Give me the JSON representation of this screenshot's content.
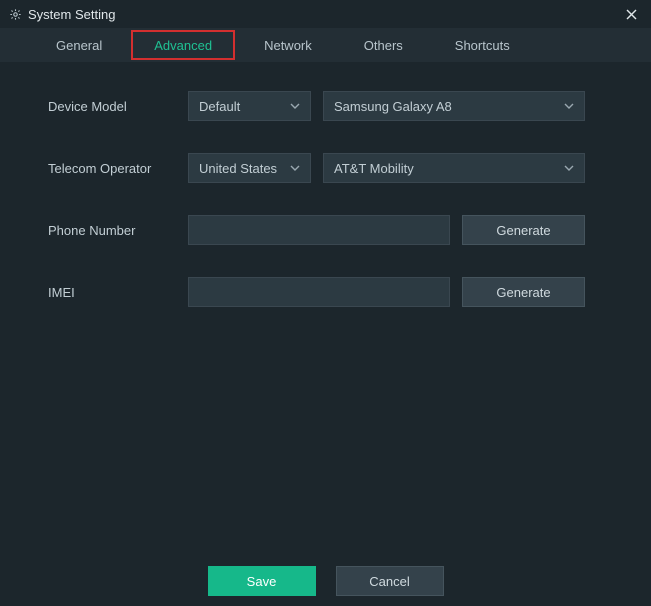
{
  "window": {
    "title": "System Setting"
  },
  "tabs": {
    "general": "General",
    "advanced": "Advanced",
    "network": "Network",
    "others": "Others",
    "shortcuts": "Shortcuts"
  },
  "form": {
    "device_model": {
      "label": "Device Model",
      "brand": "Default",
      "model": "Samsung Galaxy A8"
    },
    "telecom_operator": {
      "label": "Telecom Operator",
      "country": "United States",
      "operator": "AT&T Mobility"
    },
    "phone_number": {
      "label": "Phone Number",
      "value": "",
      "generate": "Generate"
    },
    "imei": {
      "label": "IMEI",
      "value": "",
      "generate": "Generate"
    }
  },
  "footer": {
    "save": "Save",
    "cancel": "Cancel"
  }
}
